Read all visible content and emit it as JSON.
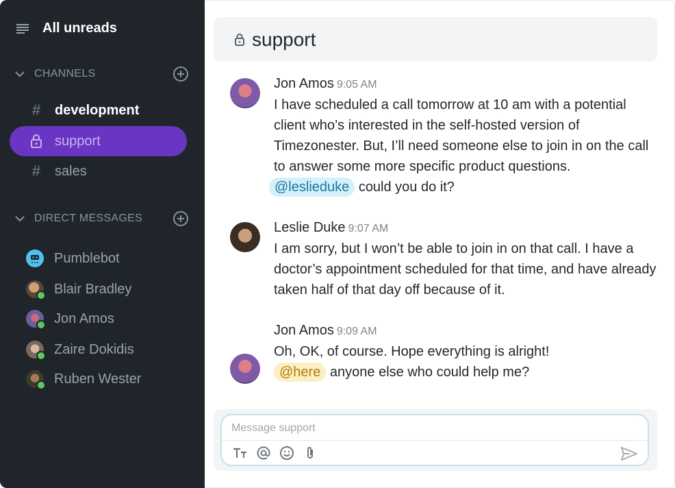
{
  "sidebar": {
    "all_unreads": "All unreads",
    "channels_header": "CHANNELS",
    "channels": [
      {
        "label": "development",
        "icon": "hash-icon",
        "bold": true
      },
      {
        "label": "support",
        "icon": "lock-icon",
        "active": true
      },
      {
        "label": "sales",
        "icon": "hash-icon"
      }
    ],
    "dm_header": "DIRECT MESSAGES",
    "dms": [
      {
        "label": "Pumblebot"
      },
      {
        "label": "Blair Bradley",
        "online": true
      },
      {
        "label": "Jon Amos",
        "online": true
      },
      {
        "label": "Zaire Dokidis",
        "online": true
      },
      {
        "label": "Ruben Wester",
        "online": true
      }
    ]
  },
  "header": {
    "title": "support"
  },
  "messages": [
    {
      "author": "Jon Amos",
      "time": "9:05 AM",
      "text": "I have scheduled a call tomorrow at 10 am with a potential client who’s interested in the self-hosted version of Timezonester. But, I’ll need someone else to join in on the call to answer some more specific product questions.",
      "mention": "@leslieduke",
      "after": "could you do it?"
    },
    {
      "author": "Leslie Duke",
      "time": "9:07 AM",
      "text": "I am sorry, but I won’t be able to join in on that call. I have a doctor’s appointment scheduled for that time, and have already taken half of that day off because of it."
    },
    {
      "author": "Jon Amos",
      "time": "9:09 AM",
      "text": "Oh, OK, of course. Hope everything is alright!",
      "mention": "@here",
      "after": "anyone else who could help me?"
    }
  ],
  "composer": {
    "placeholder": "Message support"
  },
  "colors": {
    "sidebar_bg": "#1f252b",
    "active_channel": "#6a35c2",
    "online": "#5cc95b",
    "mention_blue": "#d5effb",
    "mention_yellow": "#fcefc2"
  }
}
